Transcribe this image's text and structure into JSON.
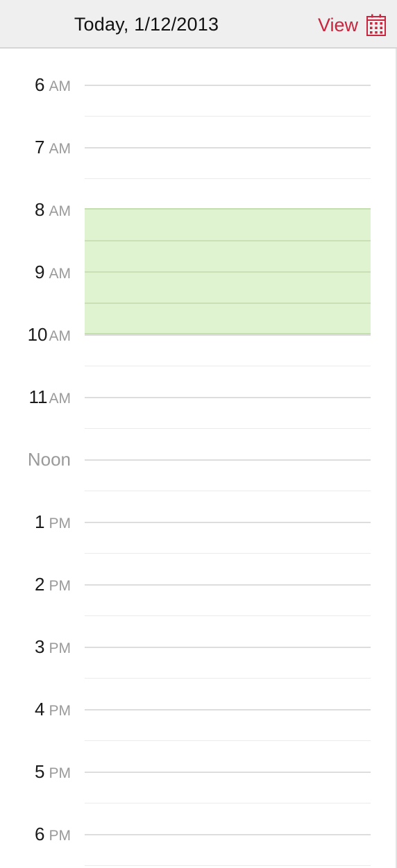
{
  "header": {
    "title": "Today, 1/12/2013",
    "view_label": "View",
    "view_icon": "calendar-grid-icon"
  },
  "colors": {
    "accent": "#c8263e",
    "event_fill": "#e0f3d0",
    "header_bg": "#efefef"
  },
  "hours": [
    {
      "num": "6",
      "ampm": "AM"
    },
    {
      "num": "7",
      "ampm": "AM"
    },
    {
      "num": "8",
      "ampm": "AM"
    },
    {
      "num": "9",
      "ampm": "AM"
    },
    {
      "num": "10",
      "ampm": "AM"
    },
    {
      "num": "11",
      "ampm": "AM"
    },
    {
      "num": "Noon",
      "ampm": ""
    },
    {
      "num": "1",
      "ampm": "PM"
    },
    {
      "num": "2",
      "ampm": "PM"
    },
    {
      "num": "3",
      "ampm": "PM"
    },
    {
      "num": "4",
      "ampm": "PM"
    },
    {
      "num": "5",
      "ampm": "PM"
    },
    {
      "num": "6",
      "ampm": "PM"
    }
  ],
  "event": {
    "start": "8 AM",
    "end": "10 AM"
  }
}
